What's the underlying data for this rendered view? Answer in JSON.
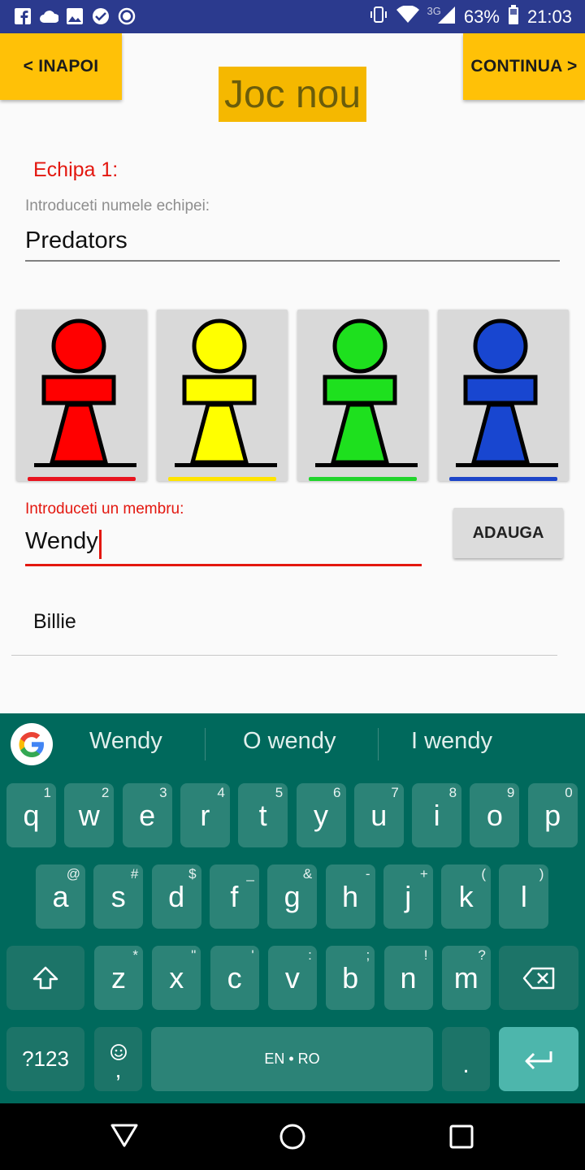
{
  "status_bar": {
    "network_label": "3G",
    "battery": "63%",
    "time": "21:03",
    "left_icons": [
      "facebook-icon",
      "cloud-icon",
      "image-icon",
      "check-icon",
      "record-icon"
    ],
    "right_icons": [
      "vibrate-icon",
      "wifi-icon",
      "signal-icon",
      "battery-icon"
    ]
  },
  "header": {
    "back_label": "< INAPOI",
    "title": "Joc nou",
    "continue_label": "CONTINUA >"
  },
  "team": {
    "label": "Echipa 1:",
    "name_hint": "Introduceti numele echipei:",
    "name_value": "Predators"
  },
  "pawns": [
    {
      "color_name": "red",
      "fill": "#ff0000",
      "bar": "#e8141f"
    },
    {
      "color_name": "yellow",
      "fill": "#ffff00",
      "bar": "#ffe400"
    },
    {
      "color_name": "green",
      "fill": "#1ee01e",
      "bar": "#21d42c"
    },
    {
      "color_name": "blue",
      "fill": "#1846d0",
      "bar": "#1c44c8"
    }
  ],
  "member": {
    "label": "Introduceti un membru:",
    "value": "Wendy",
    "add_label": "ADAUGA"
  },
  "members_list": [
    {
      "name": "Billie"
    }
  ],
  "keyboard": {
    "suggestions": [
      "Wendy",
      "O wendy",
      "I wendy"
    ],
    "row1": [
      {
        "k": "q",
        "alt": "1"
      },
      {
        "k": "w",
        "alt": "2"
      },
      {
        "k": "e",
        "alt": "3"
      },
      {
        "k": "r",
        "alt": "4"
      },
      {
        "k": "t",
        "alt": "5"
      },
      {
        "k": "y",
        "alt": "6"
      },
      {
        "k": "u",
        "alt": "7"
      },
      {
        "k": "i",
        "alt": "8"
      },
      {
        "k": "o",
        "alt": "9"
      },
      {
        "k": "p",
        "alt": "0"
      }
    ],
    "row2": [
      {
        "k": "a",
        "alt": "@"
      },
      {
        "k": "s",
        "alt": "#"
      },
      {
        "k": "d",
        "alt": "$"
      },
      {
        "k": "f",
        "alt": "_"
      },
      {
        "k": "g",
        "alt": "&"
      },
      {
        "k": "h",
        "alt": "-"
      },
      {
        "k": "j",
        "alt": "+"
      },
      {
        "k": "k",
        "alt": "("
      },
      {
        "k": "l",
        "alt": ")"
      }
    ],
    "row3": [
      {
        "k": "z",
        "alt": "*"
      },
      {
        "k": "x",
        "alt": "\""
      },
      {
        "k": "c",
        "alt": "'"
      },
      {
        "k": "v",
        "alt": ":"
      },
      {
        "k": "b",
        "alt": ";"
      },
      {
        "k": "n",
        "alt": "!"
      },
      {
        "k": "m",
        "alt": "?"
      }
    ],
    "symbols_label": "?123",
    "emoji_comma": ",",
    "space_label": "EN • RO",
    "period": ".",
    "shift_icon": "shift-icon",
    "backspace_icon": "backspace-icon",
    "enter_icon": "enter-icon",
    "emoji_icon": "emoji-icon"
  },
  "navbar": {
    "icons": [
      "back-icon",
      "home-icon",
      "recents-icon"
    ]
  },
  "colors": {
    "status_bar": "#2b3a8e",
    "accent_yellow": "#ffc107",
    "error_red": "#e3170f",
    "keyboard_bg": "#00695c",
    "key_bg": "#2c8377",
    "enter_key": "#4db6ac"
  }
}
